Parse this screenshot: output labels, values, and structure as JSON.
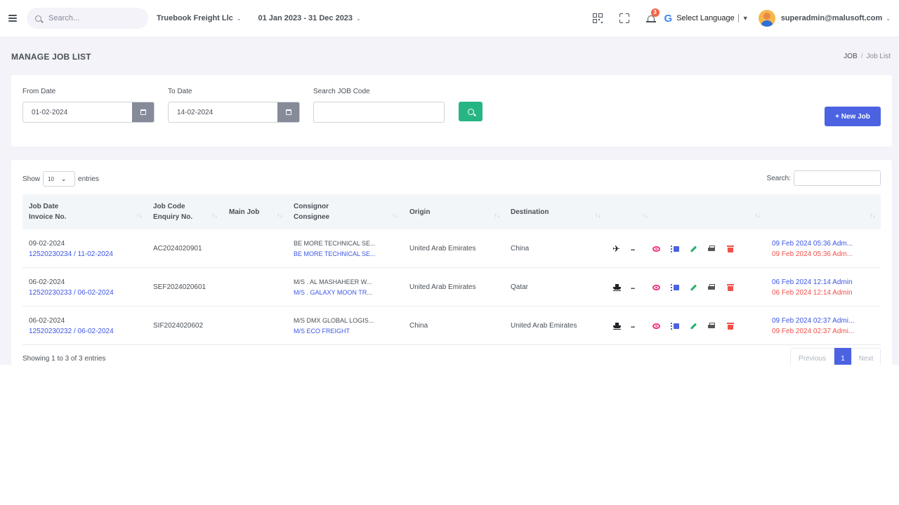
{
  "header": {
    "search_placeholder": "Search...",
    "company": "Truebook Freight Llc",
    "date_range": "01 Jan 2023 - 31 Dec 2023",
    "notification_count": "3",
    "language": "Select Language",
    "language_arrow": "▼",
    "google_letter": "G",
    "user": "superadmin@malusoft.com",
    "chevron": "⌄"
  },
  "page": {
    "title": "MANAGE JOB LIST",
    "breadcrumb": [
      "JOB",
      "Job List"
    ],
    "breadcrumb_sep": "/"
  },
  "filters": {
    "from_label": "From Date",
    "from_value": "01-02-2024",
    "to_label": "To Date",
    "to_value": "14-02-2024",
    "code_label": "Search JOB Code",
    "code_value": "",
    "new_job": "+ New Job"
  },
  "table": {
    "show_label": "Show",
    "entries_value": "10",
    "entries_label": "entries",
    "search_label": "Search:",
    "headers": {
      "job_date": "Job Date",
      "invoice": "Invoice No.",
      "job_code": "Job Code",
      "enquiry": "Enquiry No.",
      "main_job": "Main Job",
      "consignor": "Consignor",
      "consignee": "Consignee",
      "origin": "Origin",
      "destination": "Destination"
    },
    "sort_icon": "↑↓",
    "rows": [
      {
        "job_date": "09-02-2024",
        "invoice": "12520230234 / 11-02-2024",
        "job_code": "AC2024020901",
        "main_job": "",
        "consignor": "BE MORE TECHNICAL SE...",
        "consignee": "BE MORE TECHNICAL SE...",
        "origin": "United Arab Emirates",
        "destination": "China",
        "mode": "air",
        "mode_icon": "plane-icon",
        "created": "09 Feb 2024 05:36 Adm...",
        "updated": "09 Feb 2024 05:36 Adm..."
      },
      {
        "job_date": "06-02-2024",
        "invoice": "12520230233 / 06-02-2024",
        "job_code": "SEF2024020601",
        "main_job": "",
        "consignor": "M/S . AL MASHAHEER W...",
        "consignee": "M/S . GALAXY MOON TR...",
        "origin": "United Arab Emirates",
        "destination": "Qatar",
        "mode": "sea",
        "mode_icon": "ship-icon",
        "created": "06 Feb 2024 12:14 Admin",
        "updated": "06 Feb 2024 12:14 Admin"
      },
      {
        "job_date": "06-02-2024",
        "invoice": "12520230232 / 06-02-2024",
        "job_code": "SIF2024020602",
        "main_job": "",
        "consignor": "M/S DMX GLOBAL LOGIS...",
        "consignee": "M/S ECO FREIGHT",
        "origin": "China",
        "destination": "United Arab Emirates",
        "mode": "sea",
        "mode_icon": "ship-icon",
        "created": "09 Feb 2024 02:37 Admi...",
        "updated": "09 Feb 2024 02:37 Admi..."
      }
    ],
    "info": "Showing 1 to 3 of 3 entries",
    "pager": {
      "prev": "Previous",
      "current": "1",
      "next": "Next"
    },
    "ellipsis": "...",
    "plane_glyph": "✈"
  },
  "colors": {
    "primary": "#4b62e1",
    "success": "#27b584",
    "danger": "#f0514b",
    "pink": "#f1357c",
    "link": "#3b55e6"
  }
}
